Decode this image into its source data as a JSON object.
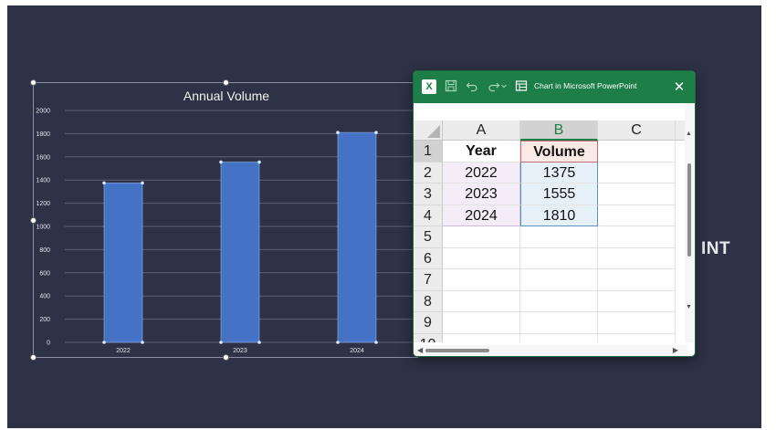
{
  "slide": {
    "background": "#2e3246",
    "partial_text": "INT"
  },
  "chart_data": {
    "type": "bar",
    "title": "Annual Volume",
    "categories": [
      "2022",
      "2023",
      "2024"
    ],
    "values": [
      1375,
      1555,
      1810
    ],
    "ylim": [
      0,
      2000
    ],
    "yticks": [
      "0",
      "200",
      "400",
      "600",
      "800",
      "1000",
      "1200",
      "1400",
      "1600",
      "1800",
      "2000"
    ],
    "xlabel": "",
    "ylabel": "",
    "grid": true,
    "bar_color": "#4472c4"
  },
  "excel": {
    "title": "Chart in Microsoft PowerPoint",
    "accent": "#1d7e47",
    "icons": [
      "excel-logo-icon",
      "save-icon",
      "undo-icon",
      "redo-icon",
      "datasheet-icon",
      "close-icon"
    ],
    "excel_glyph": "X",
    "close_glyph": "✕",
    "columns": [
      "A",
      "B",
      "C"
    ],
    "rows": [
      "1",
      "2",
      "3",
      "4",
      "5",
      "6",
      "7",
      "8",
      "9",
      "10"
    ],
    "cells": [
      [
        "Year",
        "Volume"
      ],
      [
        "2022",
        "1375"
      ],
      [
        "2023",
        "1555"
      ],
      [
        "2024",
        "1810"
      ]
    ]
  }
}
